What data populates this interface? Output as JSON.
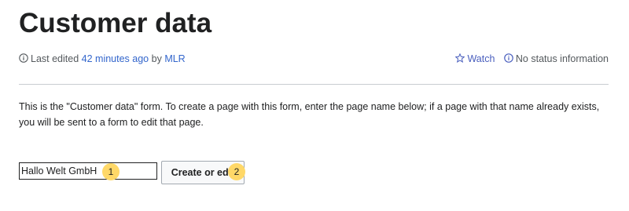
{
  "page": {
    "title": "Customer data"
  },
  "meta": {
    "last_edited_prefix": "Last edited",
    "last_edited_time": "42 minutes ago",
    "by_text": "by",
    "editor": "MLR",
    "watch_label": "Watch",
    "status_label": "No status information",
    "icons": {
      "info": "info-icon",
      "watch": "star-icon",
      "status": "info-icon"
    },
    "colors": {
      "link": "#3366cc",
      "watch": "#4a5fbe"
    }
  },
  "form": {
    "intro_text": "This is the \"Customer data\" form. To create a page with this form, enter the page name below; if a page with that name already exists, you will be sent to a form to edit that page.",
    "input_value": "Hallo Welt GmbH",
    "submit_label": "Create or edit"
  },
  "annotations": {
    "marker_1": "1",
    "marker_2": "2",
    "color": "#ffd868"
  }
}
